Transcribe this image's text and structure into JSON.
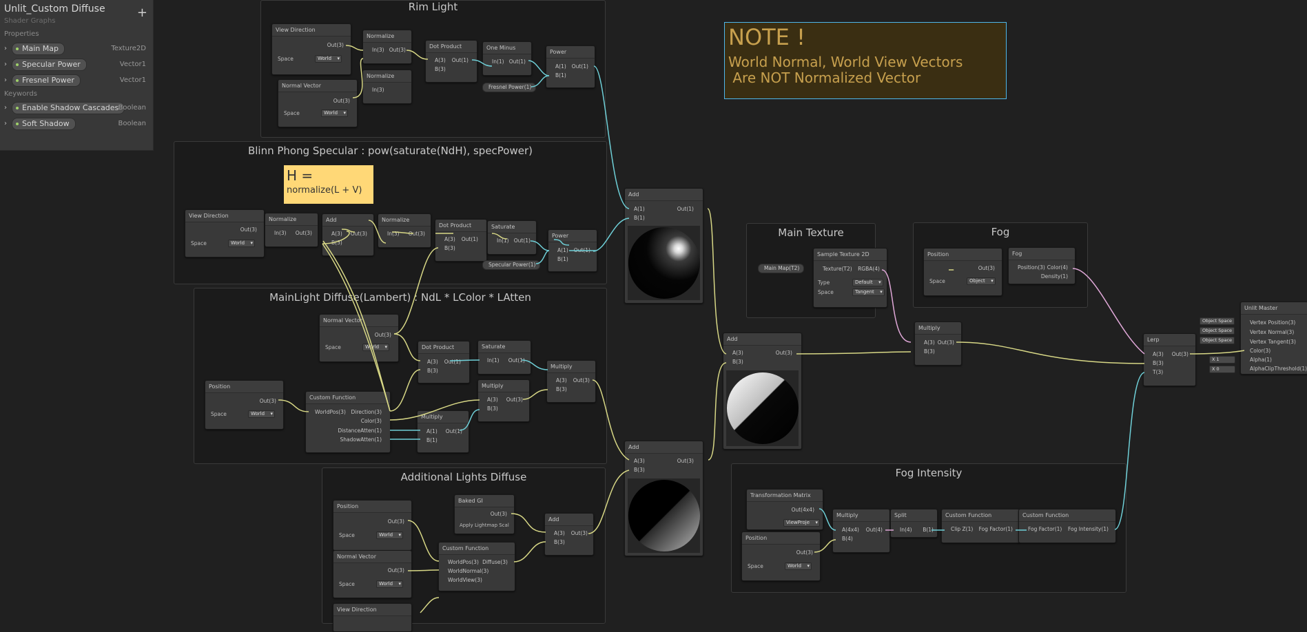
{
  "blackboard": {
    "title": "Unlit_Custom Diffuse",
    "subtitle": "Shader Graphs",
    "add_icon": "+",
    "properties_header": "Properties",
    "properties": [
      {
        "name": "Main Map",
        "type": "Texture2D"
      },
      {
        "name": "Specular Power",
        "type": "Vector1"
      },
      {
        "name": "Fresnel Power",
        "type": "Vector1"
      }
    ],
    "keywords_header": "Keywords",
    "keywords": [
      {
        "name": "Enable Shadow Cascades",
        "type": "Boolean"
      },
      {
        "name": "Soft Shadow",
        "type": "Boolean"
      }
    ]
  },
  "groups": {
    "rim": "Rim Light",
    "blinn": "Blinn Phong Specular : pow(saturate(NdH), specPower)",
    "lambert": "MainLight Diffuse(Lambert) : NdL * LColor * LAtten",
    "additional": "Additional Lights Diffuse",
    "main_texture": "Main Texture",
    "fog": "Fog",
    "fog_intensity": "Fog Intensity"
  },
  "notes": {
    "note_title": "NOTE !",
    "note_line1": "World Normal, World View Vectors",
    "note_line2": " Are NOT Normalized Vector",
    "h_title": "H =",
    "h_formula": "normalize(L + V)",
    "note_color": "#7c6a38",
    "h_color": "#ffd877"
  },
  "nodes": {
    "view_direction": "View Direction",
    "normal_vector": "Normal Vector",
    "normalize": "Normalize",
    "dot_product": "Dot Product",
    "one_minus": "One Minus",
    "power": "Power",
    "add": "Add",
    "saturate": "Saturate",
    "position": "Position",
    "custom_function": "Custom Function",
    "multiply": "Multiply",
    "baked_gi": "Baked GI",
    "sample_texture": "Sample Texture 2D",
    "fog": "Fog",
    "lerp": "Lerp",
    "unlit_master": "Unlit Master",
    "transformation_matrix": "Transformation Matrix",
    "split": "Split"
  },
  "ports": {
    "out3": "Out(3)",
    "out1": "Out(1)",
    "out4": "Out(4)",
    "in3": "In(3)",
    "in1": "In(1)",
    "in4": "In(4)",
    "a3": "A(3)",
    "b3": "B(3)",
    "a1": "A(1)",
    "b1": "B(1)",
    "a4x4": "A(4x4)",
    "b4": "B(4)",
    "t3": "T(3)",
    "space": "Space",
    "world": "World",
    "object": "Object",
    "tangent": "Tangent",
    "default": "Default",
    "type": "Type",
    "worldpos": "WorldPos(3)",
    "direction": "Direction(3)",
    "color3": "Color(3)",
    "distance_atten": "DistanceAtten(1)",
    "shadow_atten": "ShadowAtten(1)",
    "world_normal": "WorldNormal(3)",
    "world_view": "WorldView(3)",
    "diffuse": "Diffuse(3)",
    "apply_lightmap": "Apply Lightmap Scal",
    "texture": "Texture(T2)",
    "rgba": "RGBA(4)",
    "position3": "Position(3)",
    "color4": "Color(4)",
    "density": "Density(1)",
    "out4x4": "Out(4x4)",
    "view_proj": "ViewProje",
    "clip_z": "Clip Z(1)",
    "fog_factor": "Fog Factor(1)",
    "fog_intensity": "Fog Intensity(1)",
    "vertex_position": "Vertex Position(3)",
    "vertex_normal": "Vertex Normal(3)",
    "vertex_tangent": "Vertex Tangent(3)",
    "master_color": "Color(3)",
    "alpha": "Alpha(1)",
    "alpha_clip": "AlphaClipThreshold(1)",
    "object_space": "Object Space",
    "x": "X",
    "one": "1",
    "zero": "0"
  },
  "chips": {
    "fresnel_power": "Fresnel Power(1)",
    "specular_power": "Specular Power(1)",
    "main_map": "Main Map(T2)"
  },
  "colors": {
    "vec3_wire": "#d8d886",
    "vec1_wire": "#6fd0d8",
    "vec4_wire": "#e0a8d8",
    "accent_blue": "#4fb8ec"
  }
}
